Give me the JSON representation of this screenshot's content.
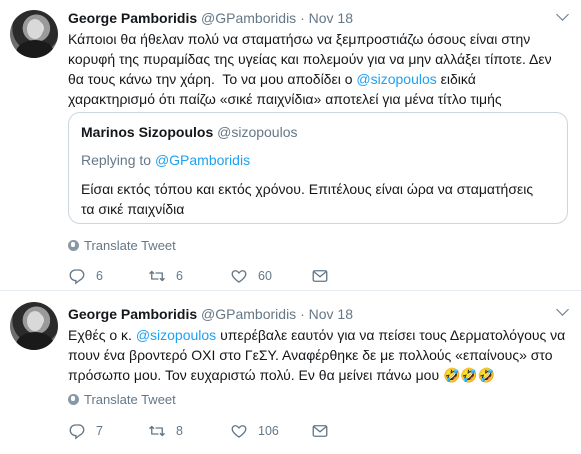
{
  "tweets": [
    {
      "name": "George Pamboridis",
      "handle": "@GPamboridis",
      "separator": "·",
      "date": "Nov 18",
      "lines": [
        {
          "parts": [
            {
              "t": "Κάποιοι θα ήθελαν πολύ να σταματήσω να ξεμπροστιάζω όσους είναι στην",
              "m": false
            }
          ]
        },
        {
          "parts": [
            {
              "t": "κορυφή της πυραμίδας της υγείας και πολεμούν για να μην αλλάξει τίποτε. Δεν",
              "m": false
            }
          ]
        },
        {
          "parts": [
            {
              "t": "θα τους κάνω την χάρη.  Το να μου αποδίδει ο ",
              "m": false
            },
            {
              "t": "@sizopoulos",
              "m": true
            },
            {
              "t": " ειδικά",
              "m": false
            }
          ]
        },
        {
          "parts": [
            {
              "t": "χαρακτηρισμό ότι παίζω «σικέ παιχνίδια» αποτελεί για μένα τίτλο τιμής",
              "m": false
            }
          ]
        }
      ],
      "quote": {
        "name": "Marinos Sizopoulos",
        "handle": "@sizopoulos",
        "replying_prefix": "Replying to ",
        "replying_to": "@GPamboridis",
        "lines": [
          "Είσαι εκτός τόπου και εκτός χρόνου. Επιτέλους είναι ώρα να σταματήσεις",
          "τα σικέ παιχνίδια"
        ]
      },
      "translate": "Translate Tweet",
      "replies": "6",
      "retweets": "6",
      "likes": "60"
    },
    {
      "name": "George Pamboridis",
      "handle": "@GPamboridis",
      "separator": "·",
      "date": "Nov 18",
      "lines": [
        {
          "parts": [
            {
              "t": "Εχθές ο κ. ",
              "m": false
            },
            {
              "t": "@sizopoulos",
              "m": true
            },
            {
              "t": " υπερέβαλε εαυτόν για να πείσει τους Δερματολόγους να",
              "m": false
            }
          ]
        },
        {
          "parts": [
            {
              "t": "πουν ένα βροντερό ΟΧΙ στο ΓεΣΥ. Αναφέρθηκε δε με πολλούς «επαίνους» στο",
              "m": false
            }
          ]
        },
        {
          "parts": [
            {
              "t": "πρόσωπο μου. Τον ευχαριστώ πολύ. Εν θα μείνει πάνω μου 🤣🤣🤣",
              "m": false
            }
          ]
        }
      ],
      "translate": "Translate Tweet",
      "replies": "7",
      "retweets": "8",
      "likes": "106"
    }
  ],
  "colors": {
    "accent": "#1da1f2",
    "secondary_text": "#657786",
    "border": "#e6ecf0"
  },
  "icons": [
    "avatar",
    "chevron-down-icon",
    "globe-icon",
    "reply-icon",
    "retweet-icon",
    "like-icon",
    "message-icon"
  ]
}
